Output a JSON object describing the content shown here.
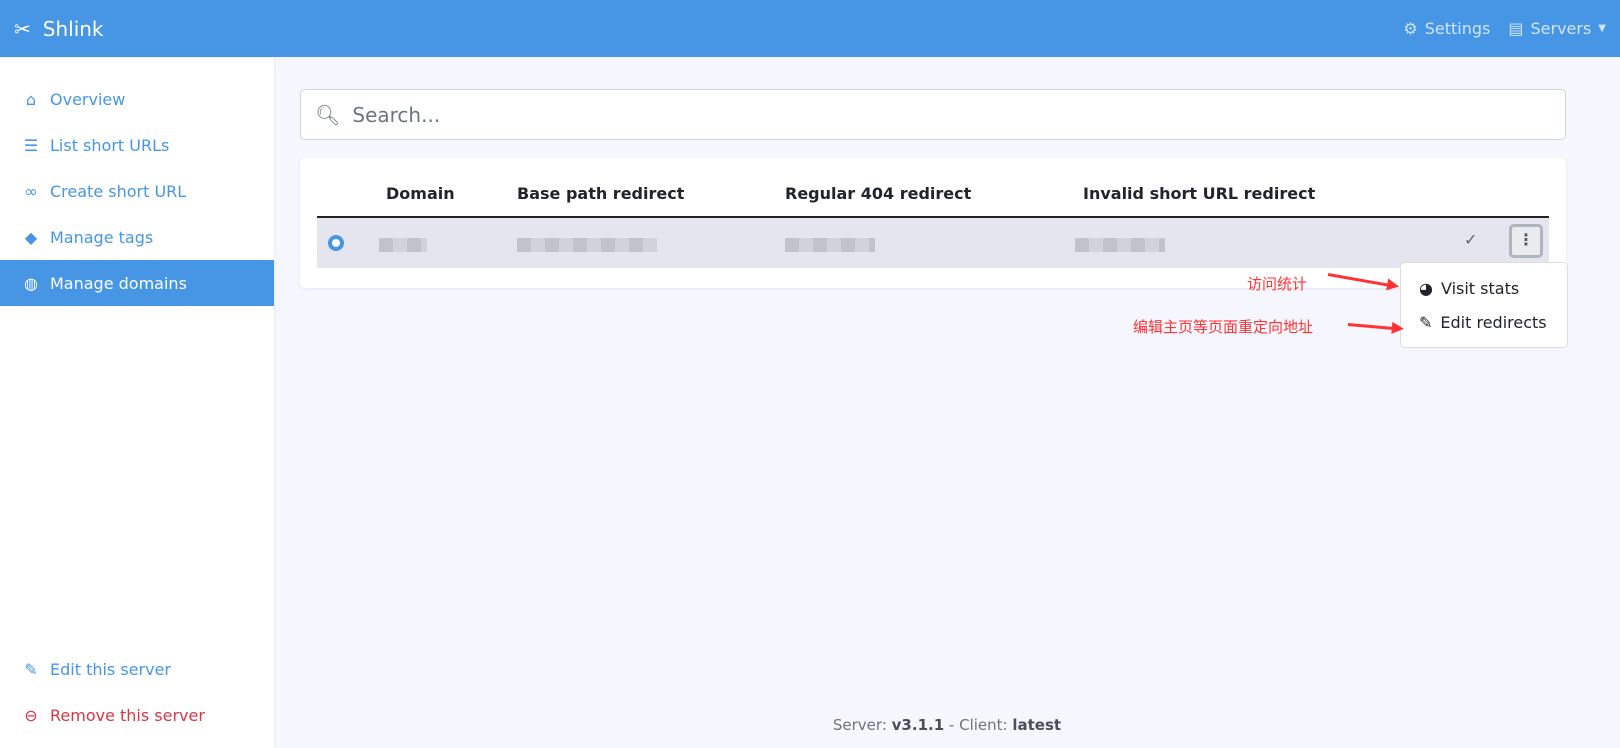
{
  "header": {
    "brand": "Shlink",
    "settings": "Settings",
    "servers": "Servers"
  },
  "sidebar": {
    "items": [
      {
        "label": "Overview"
      },
      {
        "label": "List short URLs"
      },
      {
        "label": "Create short URL"
      },
      {
        "label": "Manage tags"
      },
      {
        "label": "Manage domains"
      }
    ],
    "edit": "Edit this server",
    "remove": "Remove this server"
  },
  "search": {
    "placeholder": "Search..."
  },
  "table": {
    "headers": [
      "Domain",
      "Base path redirect",
      "Regular 404 redirect",
      "Invalid short URL redirect"
    ],
    "default_check": "✓"
  },
  "menu": {
    "visit_stats": "Visit stats",
    "edit_redirects": "Edit redirects"
  },
  "annotations": {
    "visit": "访问统计",
    "edit": "编辑主页等页面重定向地址"
  },
  "footer": {
    "server_label": "Server:",
    "server_version": "v3.1.1",
    "sep": " - Client:",
    "client_version": "latest"
  }
}
